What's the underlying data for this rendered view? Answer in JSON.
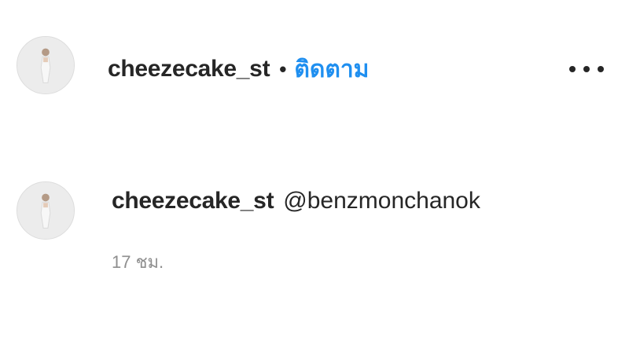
{
  "post_header": {
    "avatar_icon": "profile-avatar-icon",
    "username": "cheezecake_st",
    "separator": "•",
    "follow_label": "ติดตาม",
    "more_icon": "more-options-icon"
  },
  "comment": {
    "avatar_icon": "profile-avatar-icon",
    "username": "cheezecake_st",
    "text": "@benzmonchanok",
    "timestamp": "17 ชม."
  },
  "colors": {
    "link_blue": "#1f8ff0",
    "text_dark": "#262626",
    "text_muted": "#8e8e8e"
  }
}
